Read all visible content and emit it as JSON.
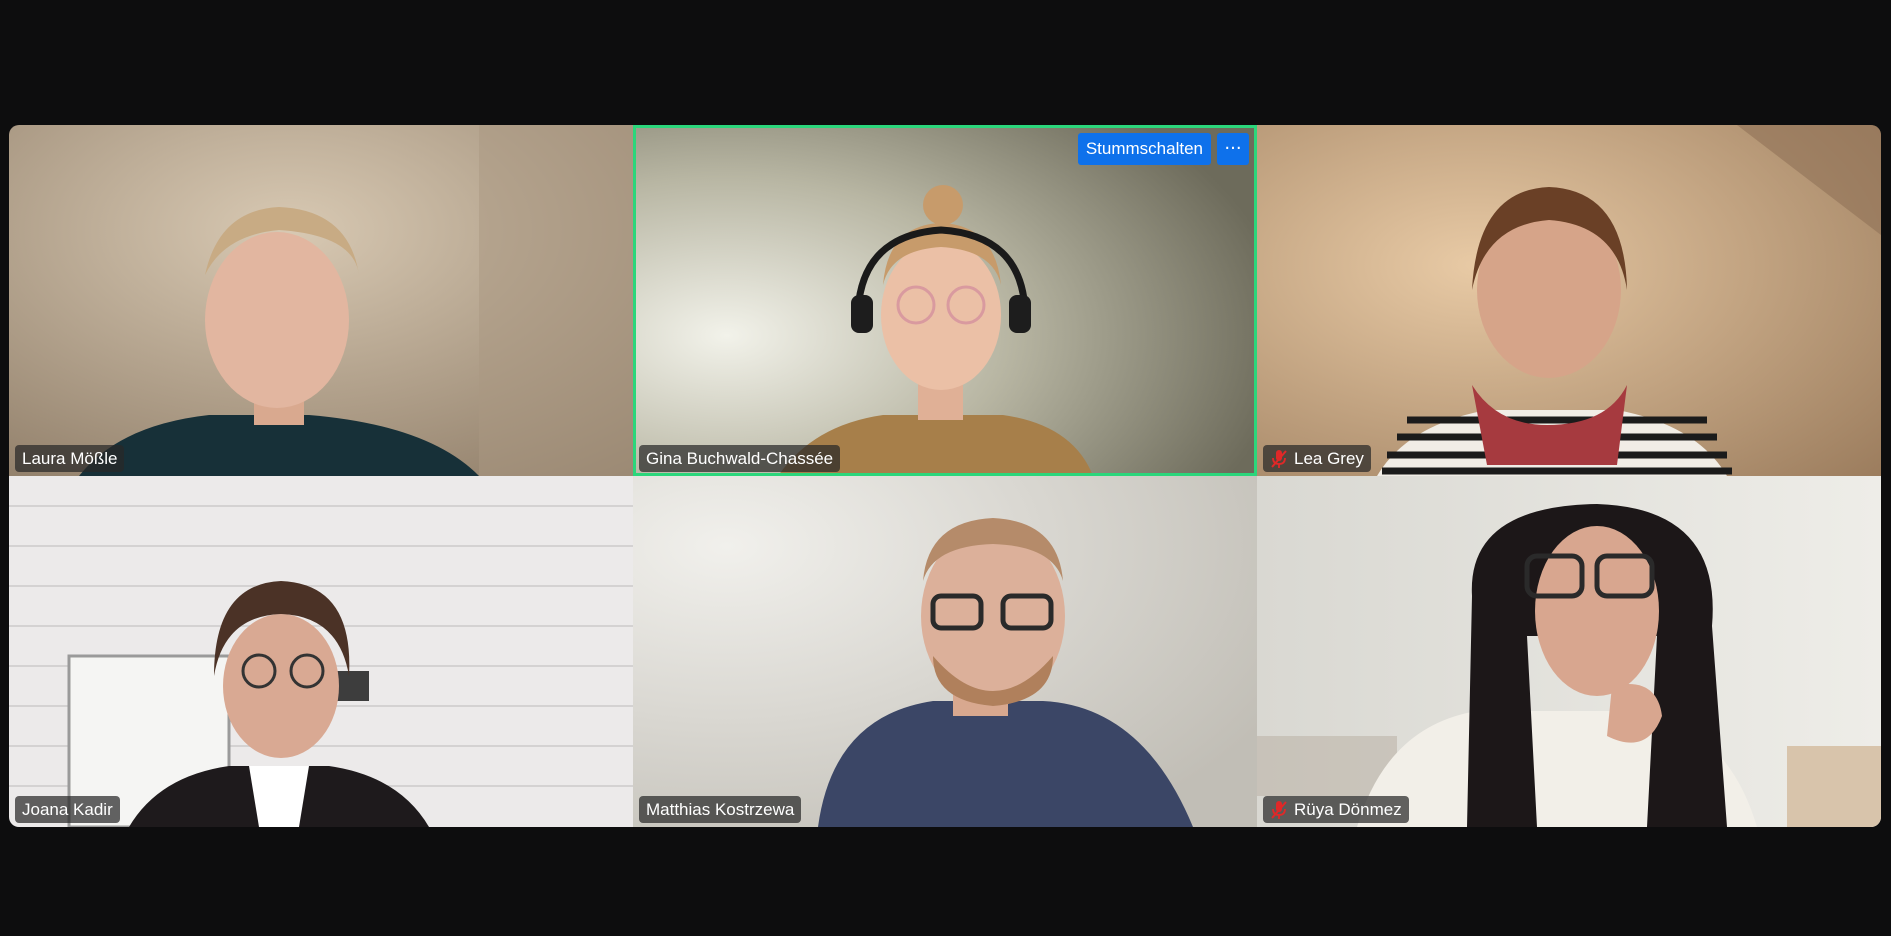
{
  "participants": [
    {
      "name": "Laura Mößle",
      "muted": false
    },
    {
      "name": "Gina Buchwald-Chassée",
      "muted": false,
      "active_speaker": true
    },
    {
      "name": "Lea Grey",
      "muted": true
    },
    {
      "name": "Joana Kadir",
      "muted": false
    },
    {
      "name": "Matthias Kostrzewa",
      "muted": false
    },
    {
      "name": "Rüya Dönmez",
      "muted": true
    }
  ],
  "tile_actions": {
    "mute_label": "Stummschalten",
    "more_label": "···"
  },
  "icons": {
    "muted": "microphone-off-icon",
    "more": "more-horizontal-icon"
  },
  "colors": {
    "background": "#0d0d0e",
    "active_border": "#2bd67b",
    "button_blue": "#0e71eb",
    "muted_red": "#e02828"
  }
}
